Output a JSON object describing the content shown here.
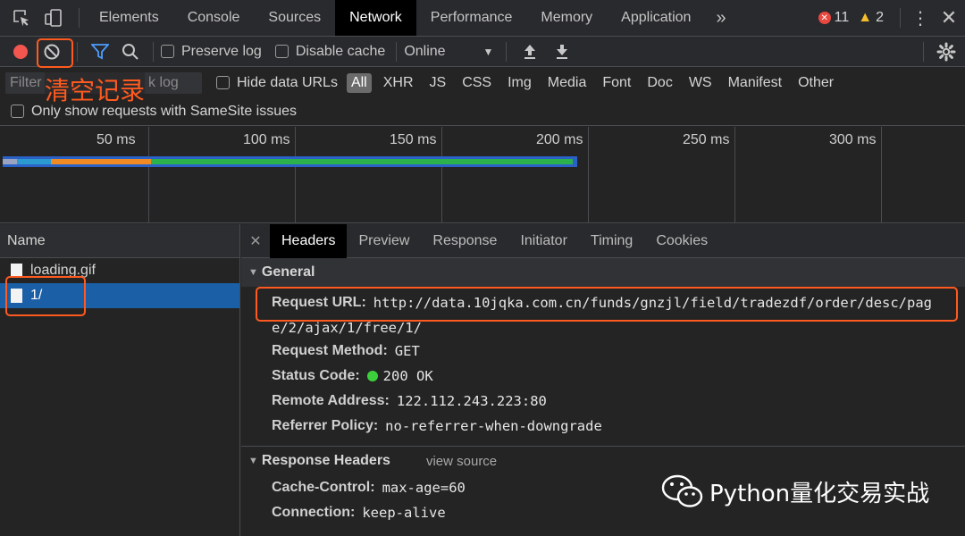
{
  "tabs": {
    "items": [
      "Elements",
      "Console",
      "Sources",
      "Network",
      "Performance",
      "Memory",
      "Application"
    ],
    "active": "Network",
    "overflow": "»",
    "error_count": "11",
    "warning_count": "2"
  },
  "toolbar": {
    "preserve_log": "Preserve log",
    "disable_cache": "Disable cache",
    "throttle": "Online"
  },
  "filter": {
    "placeholder": "Filter",
    "hidden_hint": "k log",
    "hide_data_urls": "Hide data URLs",
    "types": [
      "All",
      "XHR",
      "JS",
      "CSS",
      "Img",
      "Media",
      "Font",
      "Doc",
      "WS",
      "Manifest",
      "Other"
    ],
    "selected_type": "All",
    "samesite": "Only show requests with SameSite issues"
  },
  "timeline": {
    "ticks": [
      "50 ms",
      "100 ms",
      "150 ms",
      "200 ms",
      "250 ms",
      "300 ms"
    ]
  },
  "requests": {
    "header": "Name",
    "items": [
      "loading.gif",
      "1/"
    ],
    "selected": "1/"
  },
  "detail": {
    "tabs": [
      "Headers",
      "Preview",
      "Response",
      "Initiator",
      "Timing",
      "Cookies"
    ],
    "active_tab": "Headers",
    "general_title": "General",
    "request_url_label": "Request URL:",
    "request_url_line1": "http://data.10jqka.com.cn/funds/gnzjl/field/tradezdf/order/desc/pag",
    "request_url_line2": "e/2/ajax/1/free/1/",
    "method_label": "Request Method:",
    "method_value": "GET",
    "status_label": "Status Code:",
    "status_value": "200 OK",
    "remote_label": "Remote Address:",
    "remote_value": "122.112.243.223:80",
    "referrer_label": "Referrer Policy:",
    "referrer_value": "no-referrer-when-downgrade",
    "response_headers_title": "Response Headers",
    "view_source": "view source",
    "cache_label": "Cache-Control:",
    "cache_value": "max-age=60",
    "conn_label": "Connection:",
    "conn_value": "keep-alive"
  },
  "annotation": {
    "label": "清空记录"
  },
  "watermark": {
    "text": "Python量化交易实战"
  },
  "colors": {
    "record": "#f2564f",
    "accent_blue": "#1b5fa6",
    "annotation": "#ff5a1f",
    "status_ok": "#3cd13c"
  }
}
